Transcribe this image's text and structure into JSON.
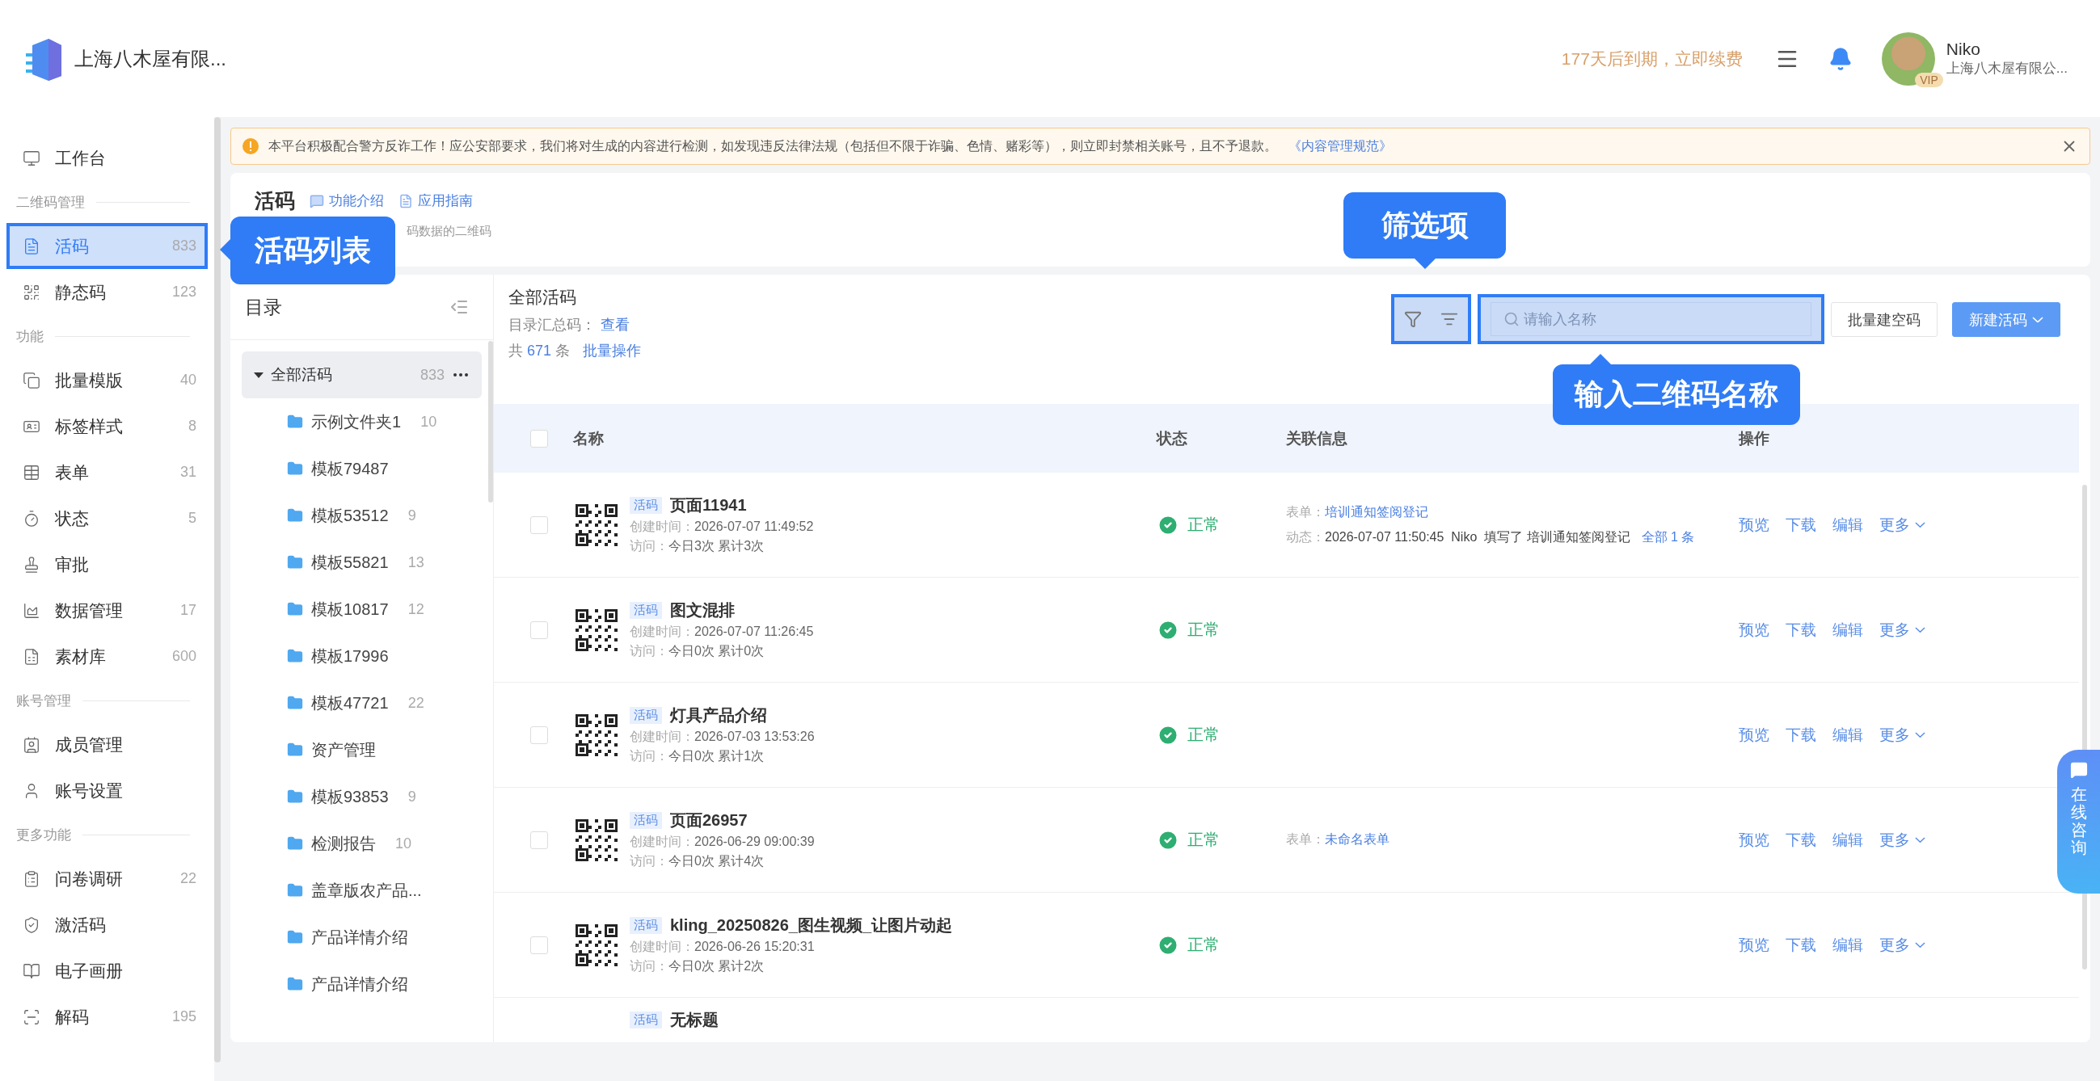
{
  "top_bar": {
    "company": "上海八木屋有限...",
    "expiry": "177天后到期，立即续费",
    "user": {
      "name": "Niko",
      "badge": "VIP",
      "org": "上海八木屋有限公..."
    }
  },
  "sidebar": {
    "items": [
      {
        "kind": "item",
        "label": "工作台",
        "selected": false,
        "highlighted": false
      },
      {
        "kind": "heading",
        "label": "二维码管理"
      },
      {
        "kind": "item",
        "label": "活码",
        "count": "833",
        "selected": true,
        "highlighted": true
      },
      {
        "kind": "item",
        "label": "静态码",
        "count": "123",
        "selected": false,
        "highlighted": false
      },
      {
        "kind": "heading",
        "label": "功能"
      },
      {
        "kind": "item",
        "label": "批量模版",
        "count": "40",
        "selected": false,
        "highlighted": false
      },
      {
        "kind": "item",
        "label": "标签样式",
        "count": "8",
        "selected": false,
        "highlighted": false
      },
      {
        "kind": "item",
        "label": "表单",
        "count": "31",
        "selected": false,
        "highlighted": false
      },
      {
        "kind": "item",
        "label": "状态",
        "count": "5",
        "selected": false,
        "highlighted": false
      },
      {
        "kind": "item",
        "label": "审批",
        "selected": false,
        "highlighted": false
      },
      {
        "kind": "item",
        "label": "数据管理",
        "count": "17",
        "selected": false,
        "highlighted": false
      },
      {
        "kind": "item",
        "label": "素材库",
        "count": "600",
        "selected": false,
        "highlighted": false
      },
      {
        "kind": "heading",
        "label": "账号管理"
      },
      {
        "kind": "item",
        "label": "成员管理",
        "selected": false,
        "highlighted": false
      },
      {
        "kind": "item",
        "label": "账号设置",
        "selected": false,
        "highlighted": false
      },
      {
        "kind": "heading",
        "label": "更多功能"
      },
      {
        "kind": "item",
        "label": "问卷调研",
        "count": "22",
        "selected": false,
        "highlighted": false
      },
      {
        "kind": "item",
        "label": "激活码",
        "selected": false,
        "highlighted": false
      },
      {
        "kind": "item",
        "label": "电子画册",
        "selected": false,
        "highlighted": false
      },
      {
        "kind": "item",
        "label": "解码",
        "count": "195",
        "selected": false,
        "highlighted": false
      }
    ]
  },
  "notice": {
    "text": "本平台积极配合警方反诈工作！应公安部要求，我们将对生成的内容进行检测，如发现违反法律法规（包括但不限于诈骗、色情、赌彩等），则立即封禁相关账号，且不予退款。",
    "link": "《内容管理规范》"
  },
  "page_header": {
    "title": "活码",
    "links": [
      "功能介绍",
      "应用指南"
    ],
    "subtitle": "码数据的二维码"
  },
  "folders": {
    "title": "目录",
    "root": {
      "label": "全部活码",
      "count": "833",
      "expanded": true,
      "selected": true,
      "children": [
        {
          "label": "示例文件夹1",
          "count": "10"
        },
        {
          "label": "模板79487"
        },
        {
          "label": "模板53512",
          "count": "9"
        },
        {
          "label": "模板55821",
          "count": "13"
        },
        {
          "label": "模板10817",
          "count": "12"
        },
        {
          "label": "模板17996"
        },
        {
          "label": "模板47721",
          "count": "22"
        },
        {
          "label": "资产管理"
        },
        {
          "label": "模板93853",
          "count": "9"
        },
        {
          "label": "检测报告",
          "count": "10"
        },
        {
          "label": "盖章版农产品..."
        },
        {
          "label": "产品详情介绍"
        },
        {
          "label": "产品详情介绍"
        }
      ]
    }
  },
  "list": {
    "title": "全部活码",
    "summary_label": "目录汇总码：",
    "summary_link": "查看",
    "total_prefix": "共",
    "total": "671",
    "total_suffix": "条",
    "batch_link": "批量操作",
    "tools_highlighted": true,
    "search": {
      "placeholder": "请输入名称",
      "highlighted": true
    },
    "buttons": [
      {
        "label": "批量建空码",
        "kind": "plain"
      },
      {
        "label": "新建活码",
        "kind": "primary"
      }
    ],
    "select_all": {
      "checked": false
    },
    "columns": [
      "名称",
      "状态",
      "关联信息",
      "操作"
    ],
    "rows": [
      {
        "kind": "full",
        "checked": false,
        "tag": "活码",
        "name": "页面11941",
        "created": {
          "label": "创建时间：",
          "value": "2026-07-07 11:49:52"
        },
        "visits": {
          "label": "访问：",
          "value": "今日3次 累计3次"
        },
        "status": {
          "label": "正常",
          "normal": true
        },
        "info": [
          {
            "label": "表单：",
            "link": "培训通知签阅登记"
          },
          {
            "label": "动态：",
            "text": "2026-07-07 11:50:45  Niko  填写了 培训通知签阅登记",
            "link": "全部 1 条"
          }
        ],
        "actions": [
          "预览",
          "下载",
          "编辑",
          "更多"
        ]
      },
      {
        "kind": "full",
        "checked": false,
        "tag": "活码",
        "name": "图文混排",
        "created": {
          "label": "创建时间：",
          "value": "2026-07-07 11:26:45"
        },
        "visits": {
          "label": "访问：",
          "value": "今日0次 累计0次"
        },
        "status": {
          "label": "正常",
          "normal": true
        },
        "actions": [
          "预览",
          "下载",
          "编辑",
          "更多"
        ]
      },
      {
        "kind": "full",
        "checked": false,
        "tag": "活码",
        "name": "灯具产品介绍",
        "created": {
          "label": "创建时间：",
          "value": "2026-07-03 13:53:26"
        },
        "visits": {
          "label": "访问：",
          "value": "今日0次 累计1次"
        },
        "status": {
          "label": "正常",
          "normal": true
        },
        "actions": [
          "预览",
          "下载",
          "编辑",
          "更多"
        ]
      },
      {
        "kind": "full",
        "checked": false,
        "tag": "活码",
        "name": "页面26957",
        "created": {
          "label": "创建时间：",
          "value": "2026-06-29 09:00:39"
        },
        "visits": {
          "label": "访问：",
          "value": "今日0次 累计4次"
        },
        "status": {
          "label": "正常",
          "normal": true
        },
        "info": [
          {
            "label": "表单：",
            "link": "未命名表单"
          }
        ],
        "actions": [
          "预览",
          "下载",
          "编辑",
          "更多"
        ]
      },
      {
        "kind": "full",
        "checked": false,
        "tag": "活码",
        "name": "kling_20250826_图生视频_让图片动起",
        "created": {
          "label": "创建时间：",
          "value": "2026-06-26 15:20:31"
        },
        "visits": {
          "label": "访问：",
          "value": "今日0次 累计2次"
        },
        "status": {
          "label": "正常",
          "normal": true
        },
        "actions": [
          "预览",
          "下载",
          "编辑",
          "更多"
        ]
      },
      {
        "kind": "partial",
        "tag": "活码",
        "name": "无标题"
      }
    ]
  },
  "chat_widget": {
    "label": "在线咨询"
  },
  "callouts": [
    {
      "text": "活码列表",
      "kind": "left"
    },
    {
      "text": "筛选项",
      "kind": "down"
    },
    {
      "text": "输入二维码名称",
      "kind": "up"
    }
  ]
}
